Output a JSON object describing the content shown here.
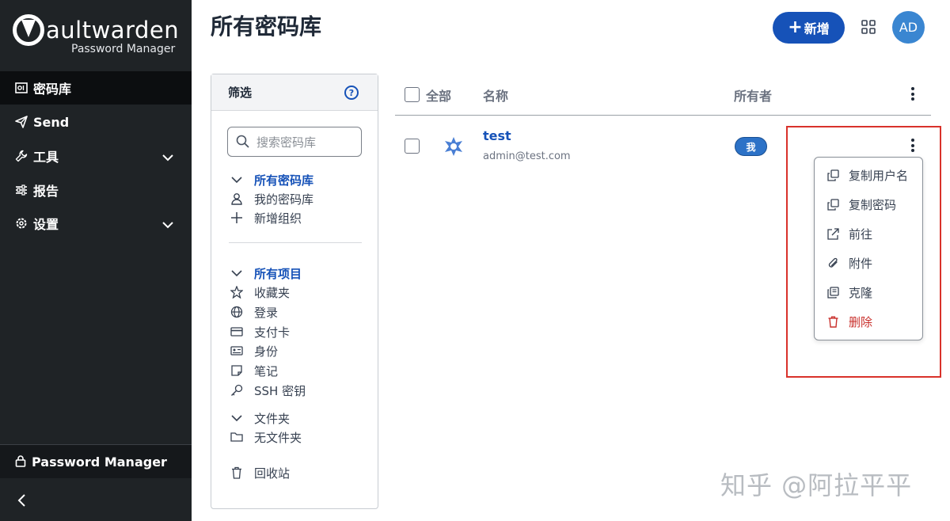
{
  "sidebar": {
    "logo_word": "aultwarden",
    "logo_sub": "Password Manager",
    "items": [
      {
        "label": "密码库",
        "icon": "vault-icon"
      },
      {
        "label": "Send",
        "icon": "paper-plane-icon"
      },
      {
        "label": "工具",
        "icon": "wrench-icon"
      },
      {
        "label": "报告",
        "icon": "sliders-icon"
      },
      {
        "label": "设置",
        "icon": "gear-icon"
      }
    ],
    "bottom": {
      "label": "Password Manager",
      "icon": "lock-icon"
    }
  },
  "header": {
    "title": "所有密码库",
    "new_label": "新增",
    "avatar": "AD"
  },
  "filter": {
    "title": "筛选",
    "search_placeholder": "搜索密码库",
    "vaults_head": "所有密码库",
    "my_vault": "我的密码库",
    "new_org": "新增组织",
    "items_head": "所有项目",
    "favorites": "收藏夹",
    "login": "登录",
    "card": "支付卡",
    "identity": "身份",
    "note": "笔记",
    "ssh": "SSH 密钥",
    "folders_head": "文件夹",
    "no_folder": "无文件夹",
    "trash": "回收站"
  },
  "table": {
    "col_all": "全部",
    "col_name": "名称",
    "col_owner": "所有者",
    "row": {
      "name": "test",
      "username": "admin@test.com",
      "owner": "我"
    }
  },
  "menu": {
    "copy_username": "复制用户名",
    "copy_password": "复制密码",
    "launch": "前往",
    "attachments": "附件",
    "clone": "克隆",
    "delete": "删除"
  },
  "watermark": "知乎 @阿拉平平",
  "colors": {
    "accent": "#1652b8",
    "sidebar": "#1f2326",
    "danger": "#c9302c",
    "highlight": "#d9322b"
  }
}
